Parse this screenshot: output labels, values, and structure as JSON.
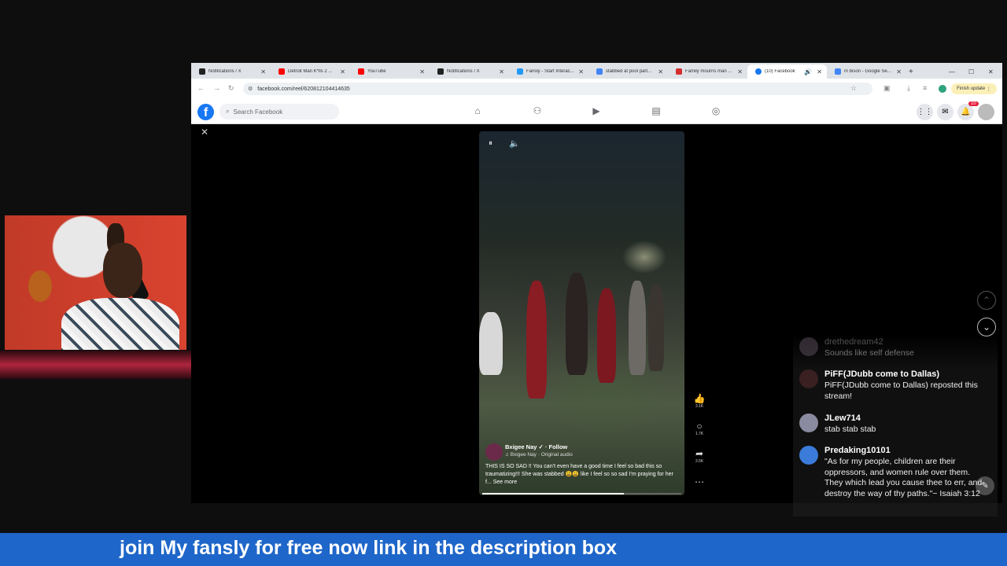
{
  "browser": {
    "tabs": [
      {
        "title": "Notifications / X",
        "icon": "x-icon",
        "color": "#000000"
      },
      {
        "title": "Detroit Man K*lls 2 ...",
        "icon": "youtube-icon",
        "color": "#ff0000"
      },
      {
        "title": "YouTube",
        "icon": "youtube-icon",
        "color": "#ff0000"
      },
      {
        "title": "Notifications / X",
        "icon": "x-icon",
        "color": "#000000"
      },
      {
        "title": "Fansly - Start Interac...",
        "icon": "fansly-icon",
        "color": "#2699f7"
      },
      {
        "title": "stabbed at pool part...",
        "icon": "google-icon",
        "color": "#4285f4"
      },
      {
        "title": "Family mourns man ...",
        "icon": "news-icon",
        "color": "#d32f2f"
      },
      {
        "title": "(10) Facebook",
        "icon": "facebook-icon",
        "color": "#1877f2"
      },
      {
        "title": "m bison - Google Se...",
        "icon": "google-icon",
        "color": "#4285f4"
      }
    ],
    "url": "facebook.com/reel/620812104414635",
    "finish_update": "Finish update"
  },
  "facebook": {
    "search_placeholder": "Search Facebook",
    "notification_count": "10"
  },
  "reel": {
    "author": "Bxigee Nay",
    "follow": "Follow",
    "audio": "Bxigee Nay · Original audio",
    "caption": "THIS IS SO SAD !! You can’t even have a good time I feel so bad this so traumatizing!!! She was stabbed 😩😩 like I feel so so sad I’m praying for her f...",
    "see_more": "See more",
    "likes": "3.1K",
    "comments": "1.7K",
    "shares": "3.5K"
  },
  "chat": [
    {
      "name": "drethedream42",
      "message": "Sounds like self defense"
    },
    {
      "name": "PiFF(JDubb come to Dallas)",
      "message": "PiFF(JDubb come to Dallas) reposted this stream!"
    },
    {
      "name": "JLew714",
      "message": "stab stab stab"
    },
    {
      "name": "Predaking10101",
      "message": "\"As for my people, children are their oppressors, and women rule over them. They which lead you cause thee to err, and destroy the way of thy paths.\"~ Isaiah 3:12"
    }
  ],
  "banner": {
    "text": "join My fansly for free now link in the description box"
  }
}
